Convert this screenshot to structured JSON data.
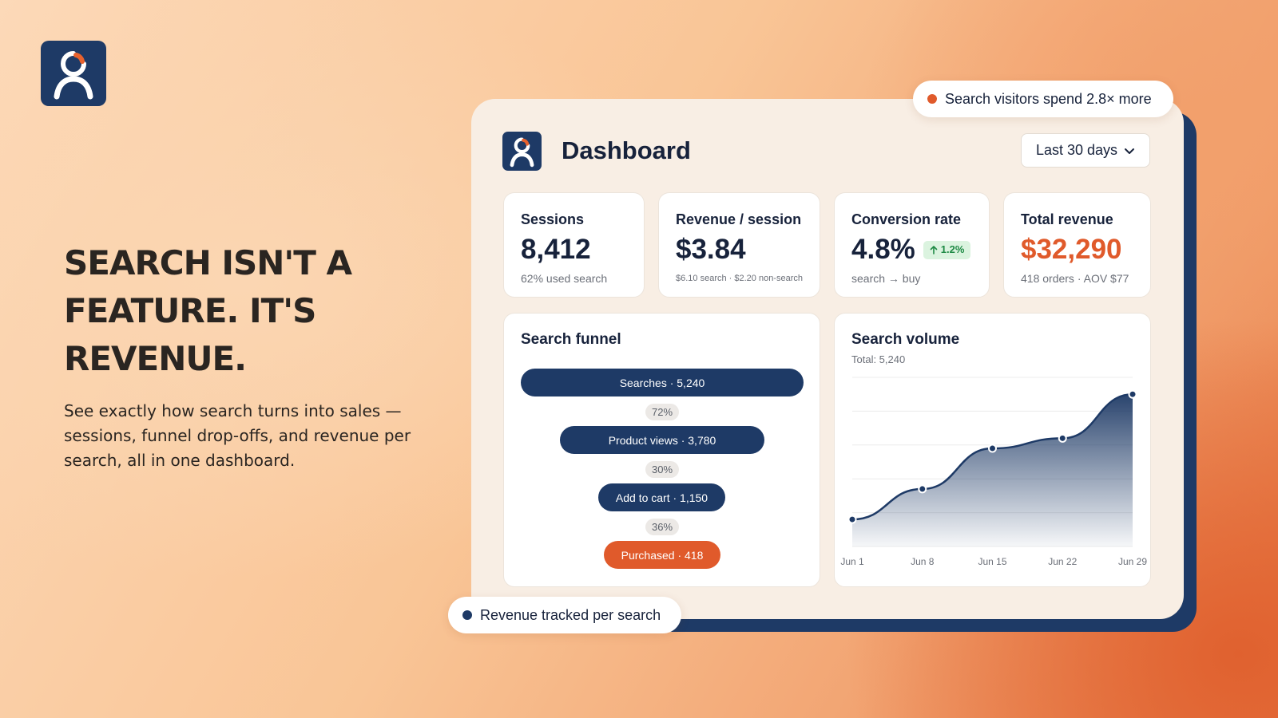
{
  "hero": {
    "headline": "Search isn't a feature. It's revenue.",
    "subtext": "See exactly how search turns into sales — sessions, funnel drop-offs, and revenue per search, all in one dashboard."
  },
  "dashboard": {
    "title": "Dashboard",
    "date_range": "Last 30 days"
  },
  "kpis": [
    {
      "label": "Sessions",
      "value": "8,412",
      "note": "62% used search"
    },
    {
      "label": "Revenue / session",
      "value": "$3.84",
      "note": "$6.10 search · $2.20 non-search"
    },
    {
      "label": "Conversion rate",
      "value": "4.8%",
      "delta": "1.2%",
      "note": "search → buy"
    },
    {
      "label": "Total revenue",
      "value": "$32,290",
      "note": "418 orders · AOV $77"
    }
  ],
  "funnel": {
    "title": "Search funnel",
    "steps": [
      {
        "label": "Searches · 5,240",
        "value": 5240
      },
      {
        "label": "Product views · 3,780",
        "value": 3780
      },
      {
        "label": "Add to cart · 1,150",
        "value": 1150
      },
      {
        "label": "Purchased · 418",
        "value": 418
      }
    ],
    "conversions": [
      "72%",
      "30%",
      "36%"
    ]
  },
  "volume": {
    "title": "Search volume",
    "subtitle": "Total: 5,240"
  },
  "chart_data": {
    "type": "area",
    "title": "Search volume",
    "x": [
      "Jun 1",
      "Jun 8",
      "Jun 15",
      "Jun 22",
      "Jun 29"
    ],
    "values": [
      8,
      17,
      29,
      32,
      45
    ],
    "ylim": [
      0,
      50
    ],
    "grid": true
  },
  "badges": {
    "top": "Search visitors spend 2.8× more",
    "bottom": "Revenue tracked per search"
  },
  "colors": {
    "navy": "#1e3a66",
    "orange": "#e05a2b",
    "green": "#1f8a45"
  },
  "icons": {
    "logo": "person-search-logo",
    "dropdown": "chevron-down-icon",
    "delta": "arrow-up-icon"
  }
}
